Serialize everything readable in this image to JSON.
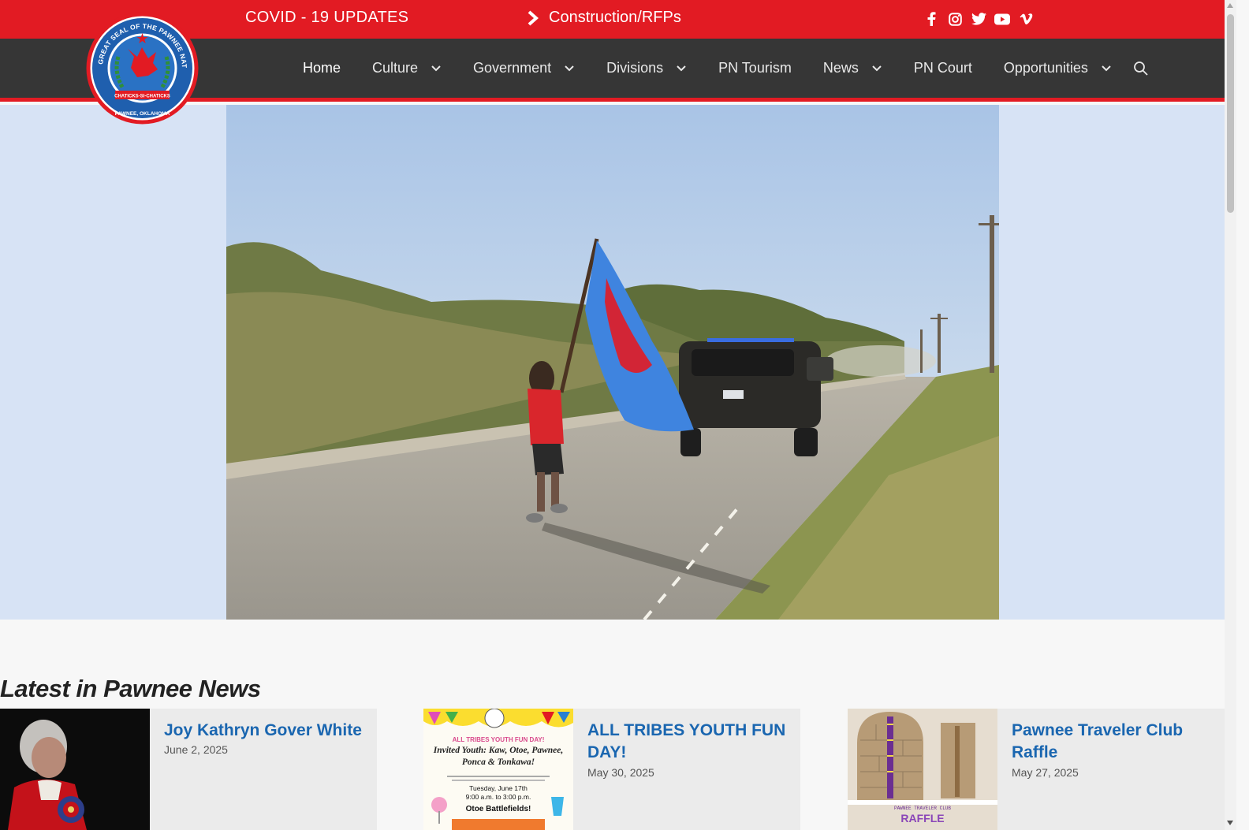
{
  "topbar": {
    "covid_link": "COVID - 19 UPDATES",
    "rfp_link": "Construction/RFPs",
    "social": [
      "facebook-icon",
      "instagram-icon",
      "twitter-icon",
      "youtube-icon",
      "vimeo-icon"
    ]
  },
  "logo": {
    "text_top": "THE GREAT SEAL OF THE PAWNEE NATION",
    "text_banner": "CHATICKS-SI-CHATICKS",
    "text_bottom": "PAWNEE, OKLAHOMA"
  },
  "nav": {
    "items": [
      {
        "label": "Home",
        "dropdown": false
      },
      {
        "label": "Culture",
        "dropdown": true
      },
      {
        "label": "Government",
        "dropdown": true
      },
      {
        "label": "Divisions",
        "dropdown": true
      },
      {
        "label": "PN Tourism",
        "dropdown": false
      },
      {
        "label": "News",
        "dropdown": true
      },
      {
        "label": "PN Court",
        "dropdown": false
      },
      {
        "label": "Opportunities",
        "dropdown": true
      }
    ]
  },
  "news": {
    "heading": "Latest in Pawnee News",
    "cards": [
      {
        "title": "Joy Kathryn Gover White",
        "date": "June 2, 2025"
      },
      {
        "title": "ALL TRIBES YOUTH FUN DAY!",
        "date": "May 30, 2025"
      },
      {
        "title": "Pawnee Traveler Club Raffle",
        "date": "May 27, 2025"
      }
    ],
    "flyer": {
      "headline": "ALL TRIBES YOUTH FUN DAY!",
      "invite": "Invited Youth: Kaw, Otoe, Pawnee, Ponca & Tonkawa!",
      "date": "Tuesday, June 17th",
      "time": "9:00 a.m. to 3:00 p.m.",
      "place": "Otoe Battlefields!"
    },
    "raffle": {
      "club": "PAWNEE TRAVELER CLUB",
      "word": "RAFFLE"
    }
  },
  "colors": {
    "topbar": "#e21b23",
    "navbar": "#363636",
    "link": "#1a66b0",
    "hero_bg": "#d7e3f5"
  }
}
